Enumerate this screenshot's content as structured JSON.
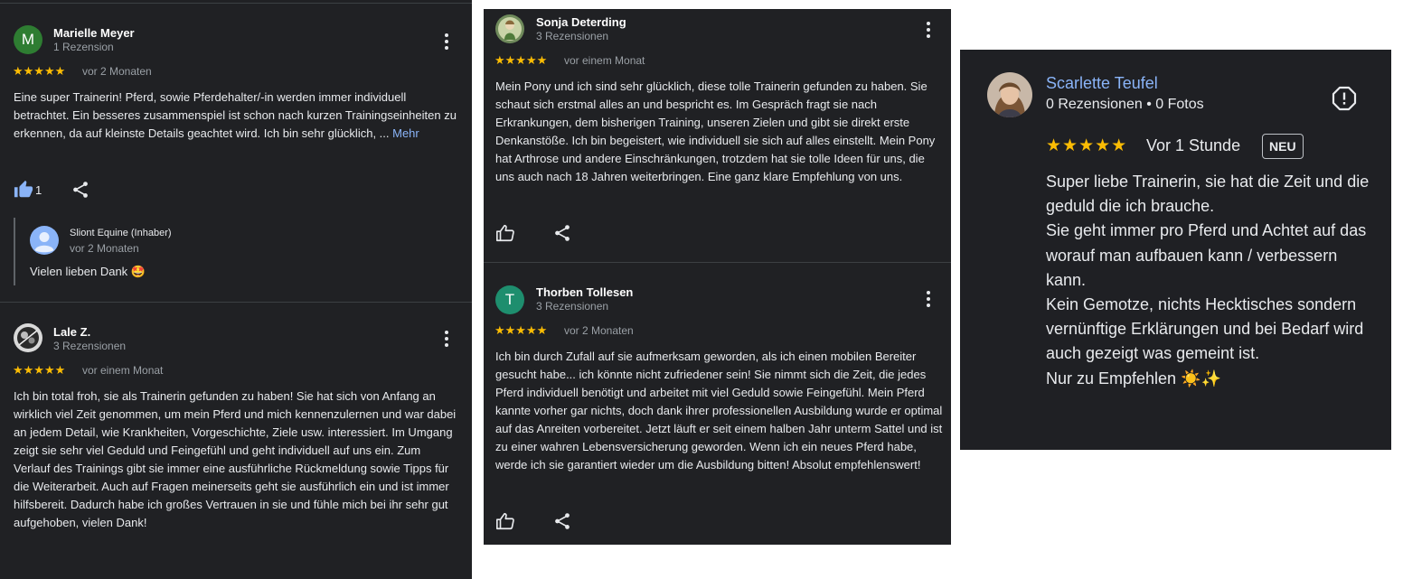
{
  "panel_left": {
    "review1": {
      "avatar_letter": "M",
      "author": "Marielle Meyer",
      "author_meta": "1 Rezension",
      "stars": "★★★★★",
      "date": "vor 2 Monaten",
      "text": "Eine super Trainerin! Pferd, sowie Pferdehalter/-in werden immer individuell betrachtet. Ein besseres zusammenspiel ist schon nach kurzen Trainingseinheiten zu erkennen, da auf kleinste Details geachtet wird. Ich bin sehr glücklich, ...",
      "more_label": "Mehr",
      "like_count": "1",
      "reply": {
        "author": "Sliont Equine (Inhaber)",
        "date": "vor 2 Monaten",
        "text": "Vielen lieben Dank 🤩"
      }
    },
    "review2": {
      "author": "Lale Z.",
      "author_meta": "3 Rezensionen",
      "stars": "★★★★★",
      "date": "vor einem Monat",
      "text": "Ich bin total froh, sie als Trainerin gefunden zu haben! Sie hat sich von Anfang an wirklich viel Zeit genommen, um mein Pferd und mich kennenzulernen und war dabei an jedem Detail, wie Krankheiten, Vorgeschichte, Ziele usw. interessiert. Im Umgang zeigt sie sehr viel Geduld und Feingefühl und geht individuell auf uns ein. Zum Verlauf des Trainings gibt sie immer eine ausführliche Rückmeldung sowie Tipps für die Weiterarbeit. Auch auf Fragen meinerseits geht sie ausführlich ein und ist immer hilfsbereit. Dadurch habe ich großes Vertrauen in sie und fühle mich bei ihr sehr gut aufgehoben, vielen Dank!"
    }
  },
  "panel_middle": {
    "review1": {
      "author": "Sonja Deterding",
      "author_meta": "3 Rezensionen",
      "stars": "★★★★★",
      "date": "vor einem Monat",
      "text": "Mein Pony und ich sind sehr glücklich, diese tolle Trainerin gefunden zu haben. Sie schaut sich erstmal alles an und bespricht es. Im Gespräch fragt sie nach Erkrankungen, dem bisherigen Training, unseren Zielen und gibt sie direkt erste Denkanstöße. Ich bin begeistert, wie individuell sie sich auf alles einstellt. Mein Pony hat Arthrose und andere Einschränkungen, trotzdem hat sie tolle Ideen für uns, die uns auch nach 18 Jahren weiterbringen. Eine ganz klare Empfehlung von uns."
    },
    "review2": {
      "avatar_letter": "T",
      "author": "Thorben Tollesen",
      "author_meta": "3 Rezensionen",
      "stars": "★★★★★",
      "date": "vor 2 Monaten",
      "text": "Ich bin durch Zufall auf sie aufmerksam geworden, als ich einen mobilen Bereiter gesucht habe... ich könnte nicht zufriedener sein! Sie nimmt sich die Zeit, die jedes Pferd individuell benötigt und arbeitet mit viel Geduld sowie Feingefühl. Mein Pferd kannte vorher gar nichts, doch dank ihrer professionellen Ausbildung wurde er optimal auf das Anreiten vorbereitet. Jetzt läuft er seit einem halben Jahr unterm Sattel und ist zu einer wahren Lebensversicherung geworden. Wenn ich ein neues Pferd habe, werde ich sie garantiert wieder um die Ausbildung bitten! Absolut empfehlenswert!"
    }
  },
  "panel_right": {
    "author": "Scarlette Teufel",
    "author_meta": "0 Rezensionen • 0 Fotos",
    "stars": "★★★★★",
    "date": "Vor 1 Stunde",
    "badge": "NEU",
    "text": "Super liebe Trainerin, sie hat die Zeit und die geduld die ich brauche.\nSie geht immer pro Pferd und Achtet auf das worauf man aufbauen kann / verbessern kann.\nKein Gemotze, nichts Hecktisches sondern vernünftige Erklärungen und bei Bedarf wird auch gezeigt was gemeint ist.\nNur zu Empfehlen ☀️✨"
  },
  "colors": {
    "background": "#202124",
    "star": "#fbbc04",
    "link": "#8ab4f8",
    "avatar_m": "#2e7d32",
    "avatar_t": "#1e8e6e"
  }
}
